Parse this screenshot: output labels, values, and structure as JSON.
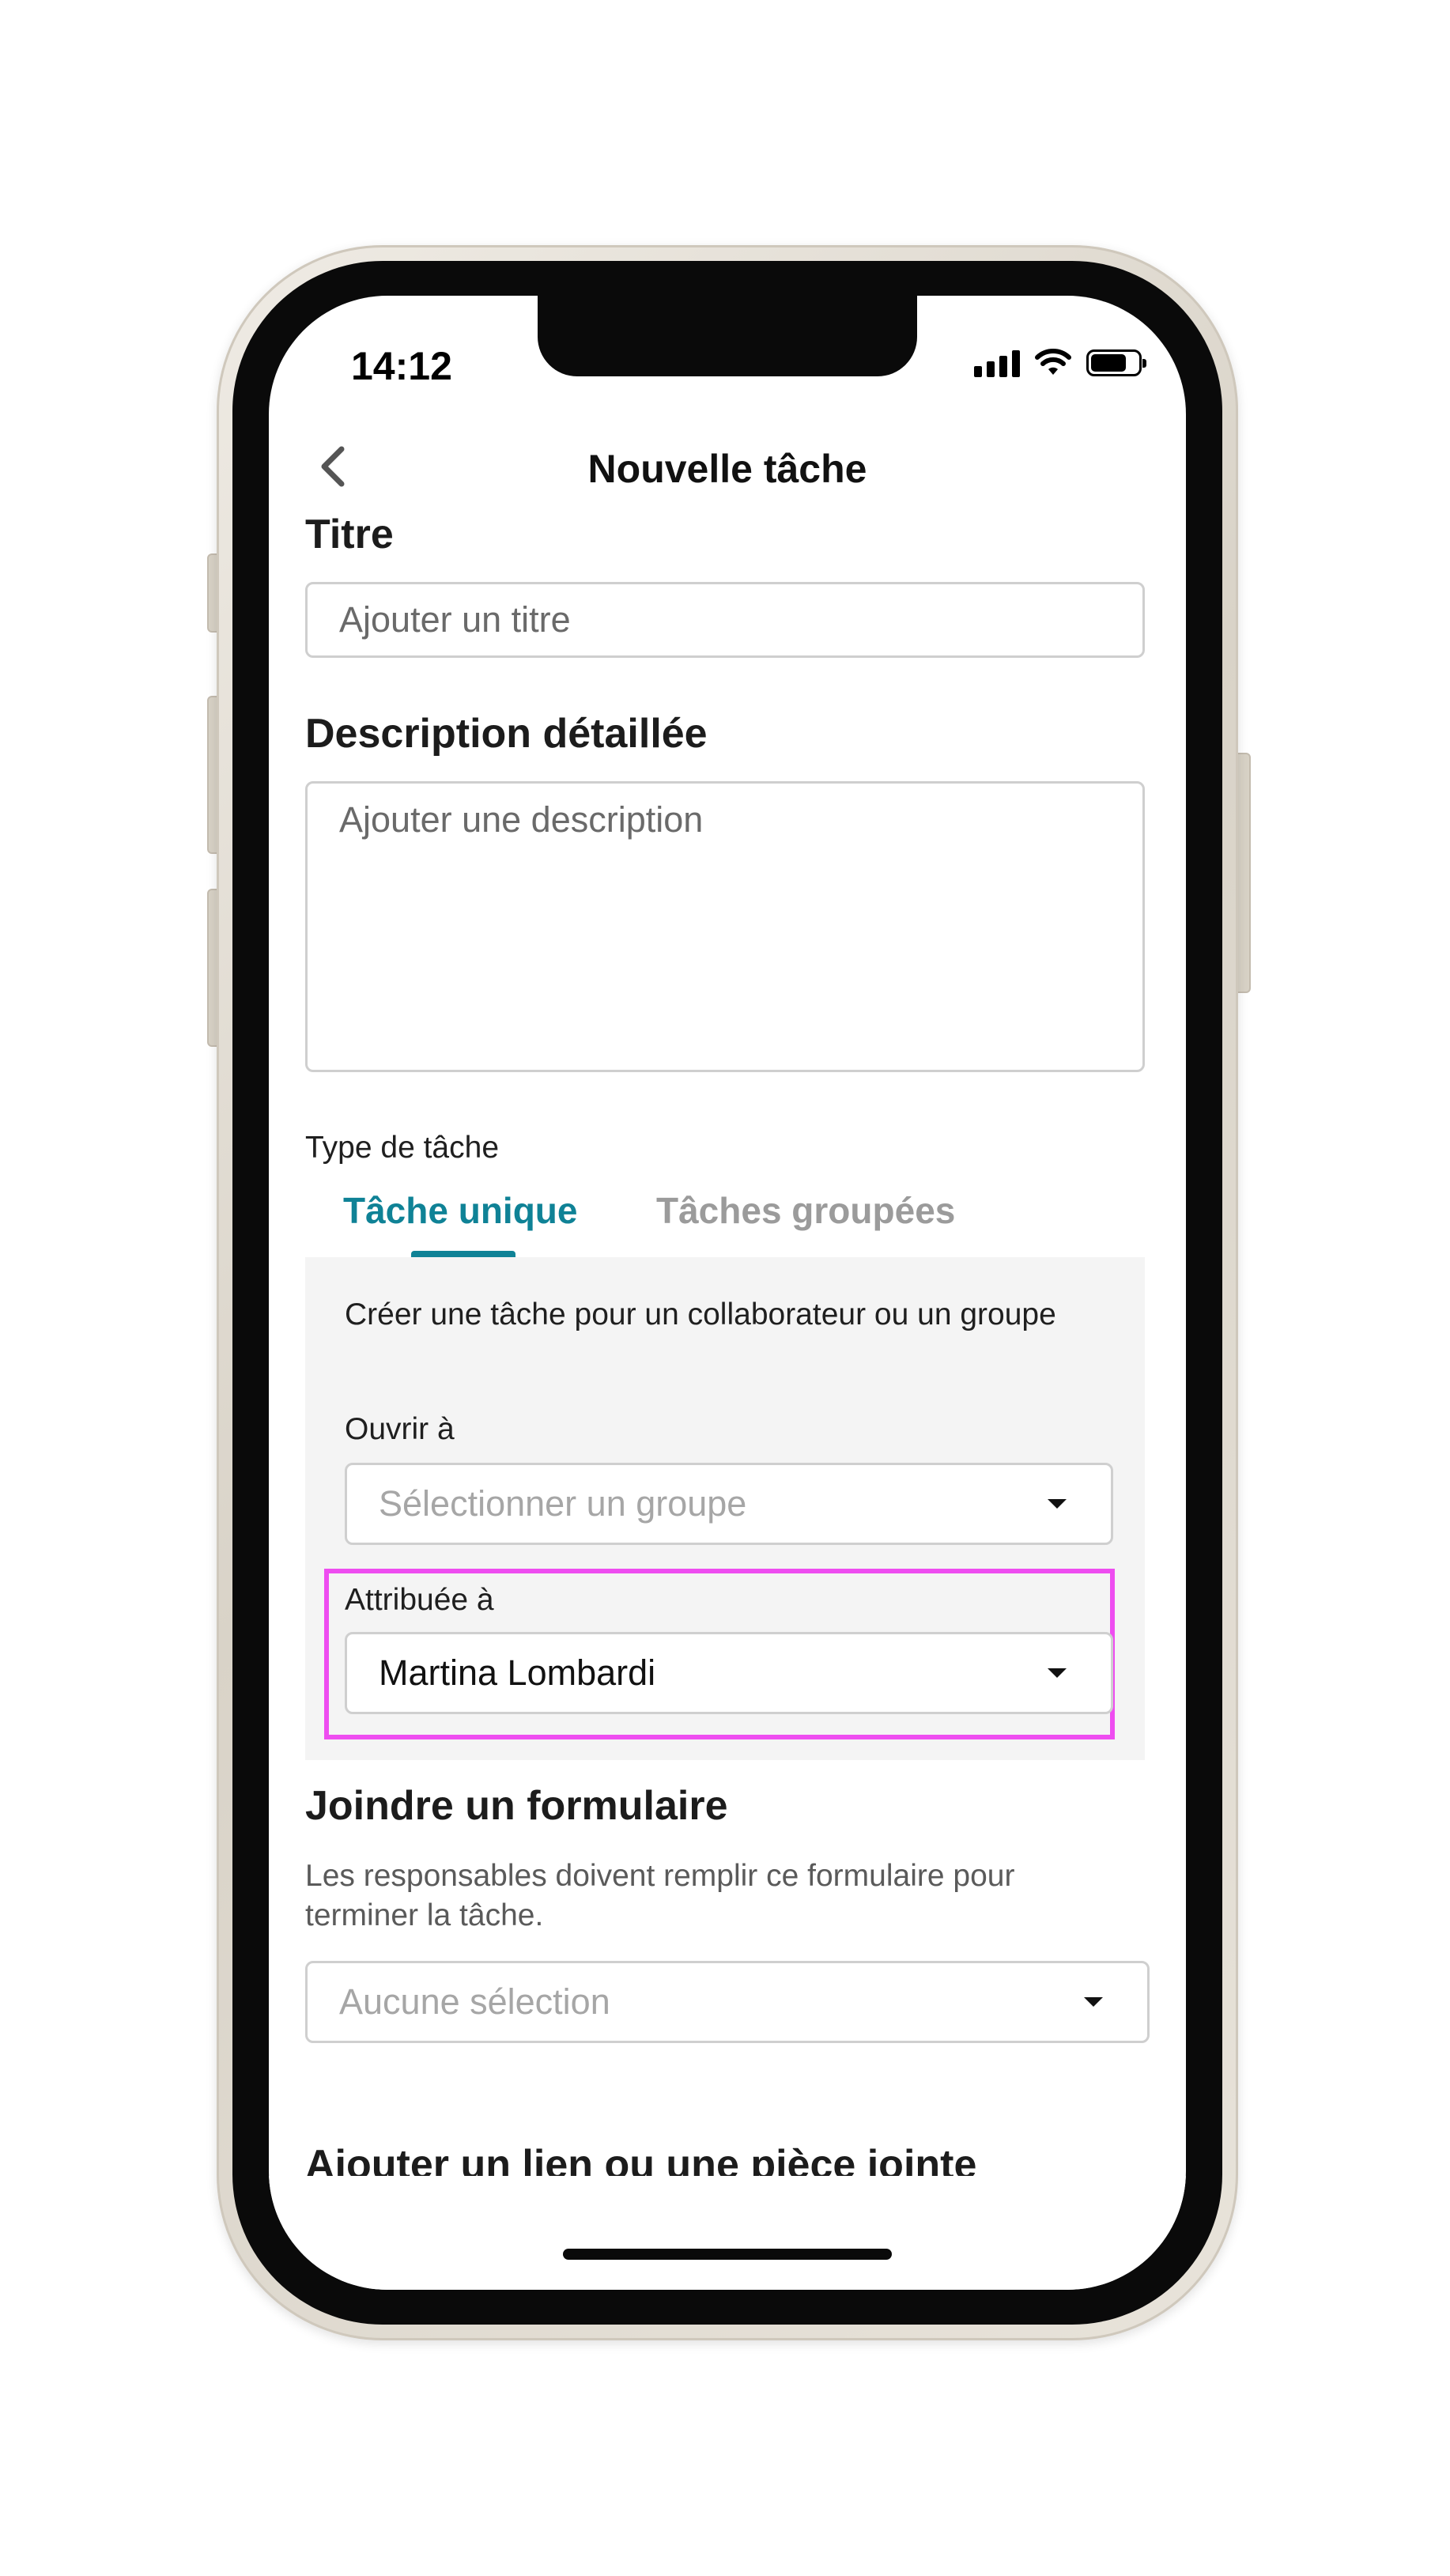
{
  "status_bar": {
    "time": "14:12",
    "signal_icon": "signal-icon",
    "wifi_icon": "wifi-icon",
    "battery_icon": "battery-icon"
  },
  "nav": {
    "title": "Nouvelle tâche",
    "back_icon": "chevron-left-icon"
  },
  "title_section": {
    "heading": "Titre",
    "placeholder": "Ajouter un titre"
  },
  "description_section": {
    "heading": "Description détaillée",
    "placeholder": "Ajouter une description"
  },
  "task_type": {
    "label": "Type de tâche",
    "tabs": [
      {
        "label": "Tâche unique",
        "active": true
      },
      {
        "label": "Tâches groupées",
        "active": false
      }
    ],
    "panel_text": "Créer une tâche pour un collaborateur ou un groupe",
    "open_to": {
      "label": "Ouvrir à",
      "placeholder": "Sélectionner un groupe"
    },
    "assigned_to": {
      "label": "Attribuée à",
      "value": "Martina Lombardi"
    }
  },
  "form_section": {
    "heading": "Joindre un formulaire",
    "subtitle": "Les responsables doivent remplir ce formulaire pour terminer la tâche.",
    "placeholder": "Aucune sélection"
  },
  "attachment_section": {
    "heading": "Ajouter un lien ou une pièce jointe"
  },
  "colors": {
    "accent": "#0f8296",
    "highlight": "#ee4df0",
    "panel_bg": "#f4f4f4"
  }
}
